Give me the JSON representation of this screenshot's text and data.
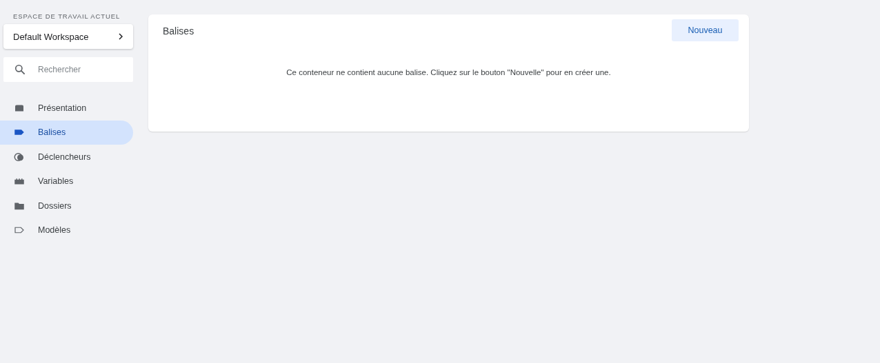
{
  "sidebar": {
    "workspace_label": "ESPACE DE TRAVAIL ACTUEL",
    "workspace": "Default Workspace",
    "search": {
      "placeholder": "Rechercher"
    },
    "items": [
      {
        "label": "Présentation",
        "kind": "overview",
        "selected": false
      },
      {
        "label": "Balises",
        "kind": "tags",
        "selected": true
      },
      {
        "label": "Déclencheurs",
        "kind": "triggers",
        "selected": false
      },
      {
        "label": "Variables",
        "kind": "variables",
        "selected": false
      },
      {
        "label": "Dossiers",
        "kind": "folders",
        "selected": false
      },
      {
        "label": "Modèles",
        "kind": "templates",
        "selected": false
      }
    ]
  },
  "card": {
    "title": "Balises",
    "button": "Nouveau",
    "message": "Ce conteneur ne contient aucune balise. Cliquez sur le bouton \"Nouvelle\" pour en créer une."
  }
}
